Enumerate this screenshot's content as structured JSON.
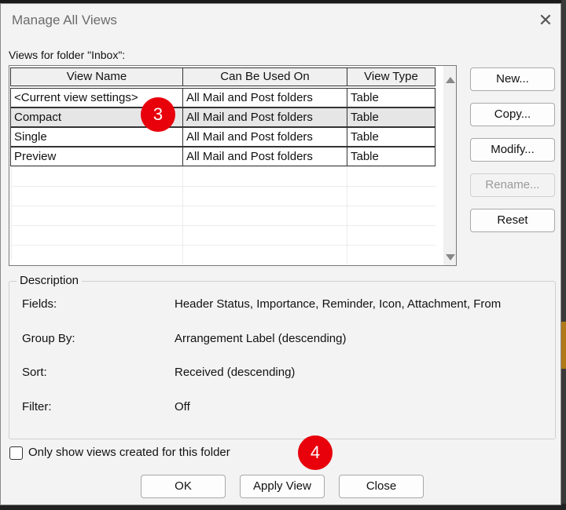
{
  "window": {
    "title": "Manage All Views",
    "close_glyph": "✕"
  },
  "views_label": "Views for folder \"Inbox\":",
  "table": {
    "columns": [
      "View Name",
      "Can Be Used On",
      "View Type"
    ],
    "rows": [
      [
        "<Current view settings>",
        "All Mail and Post folders",
        "Table"
      ],
      [
        "Compact",
        "All Mail and Post folders",
        "Table"
      ],
      [
        "Single",
        "All Mail and Post folders",
        "Table"
      ],
      [
        "Preview",
        "All Mail and Post folders",
        "Table"
      ]
    ],
    "selected_row": 1
  },
  "buttons": {
    "new": "New...",
    "copy": "Copy...",
    "modify": "Modify...",
    "rename": "Rename...",
    "reset": "Reset"
  },
  "description": {
    "title": "Description",
    "fields_label": "Fields:",
    "fields_value": "Header Status, Importance, Reminder, Icon, Attachment, From",
    "groupby_label": "Group By:",
    "groupby_value": "Arrangement Label (descending)",
    "sort_label": "Sort:",
    "sort_value": "Received (descending)",
    "filter_label": "Filter:",
    "filter_value": "Off"
  },
  "only_show_checkbox": {
    "label": "Only show views created for this folder",
    "checked": false
  },
  "footer": {
    "ok": "OK",
    "apply": "Apply View",
    "close": "Close"
  },
  "markers": [
    "3",
    "4"
  ],
  "colors": {
    "marker": "#e8000b",
    "selected_row": "#e6e6e6"
  }
}
